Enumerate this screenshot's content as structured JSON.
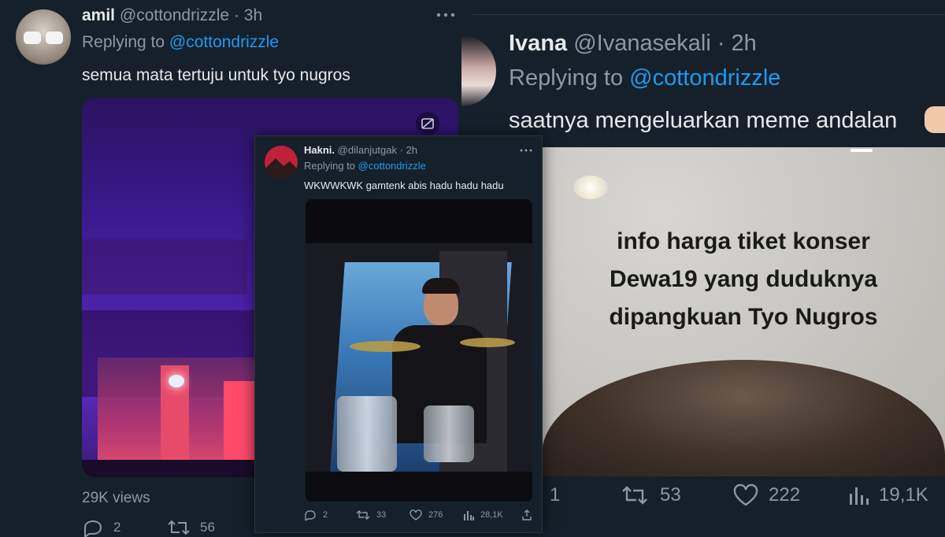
{
  "left_tweet": {
    "display_name": "amil",
    "handle": "@cottondrizzle",
    "time": "· 3h",
    "replying_label": "Replying to",
    "replying_handle": "@cottondrizzle",
    "text": "semua mata tertuju untuk tyo nugros",
    "views": "29K views",
    "replies": "2",
    "retweets": "56",
    "more_icon": "more-horizontal-icon"
  },
  "middle_tweet": {
    "display_name": "Hakni.",
    "handle": "@dilanjutgak",
    "time": "· 2h",
    "replying_label": "Replying to",
    "replying_handle": "@cottondrizzle",
    "text": "WKWWKWK gamtenk abis hadu hadu hadu",
    "replies": "2",
    "retweets": "33",
    "likes": "276",
    "views": "28,1K"
  },
  "right_tweet": {
    "display_name": "Ivana",
    "handle": "@Ivanasekali",
    "time": "· 2h",
    "replying_label": "Replying to",
    "replying_handle": "@cottondrizzle",
    "text": "saatnya mengeluarkan meme andalan",
    "media_caption_lines": [
      "info harga tiket konser",
      "Dewa19 yang duduknya",
      "dipangkuan Tyo Nugros"
    ],
    "replies": "1",
    "retweets": "53",
    "likes": "222",
    "views": "19,1K"
  },
  "colors": {
    "background": "#15202b",
    "accent": "#1d9bf0",
    "muted": "#8b98a5",
    "text": "#e7e9ea"
  }
}
